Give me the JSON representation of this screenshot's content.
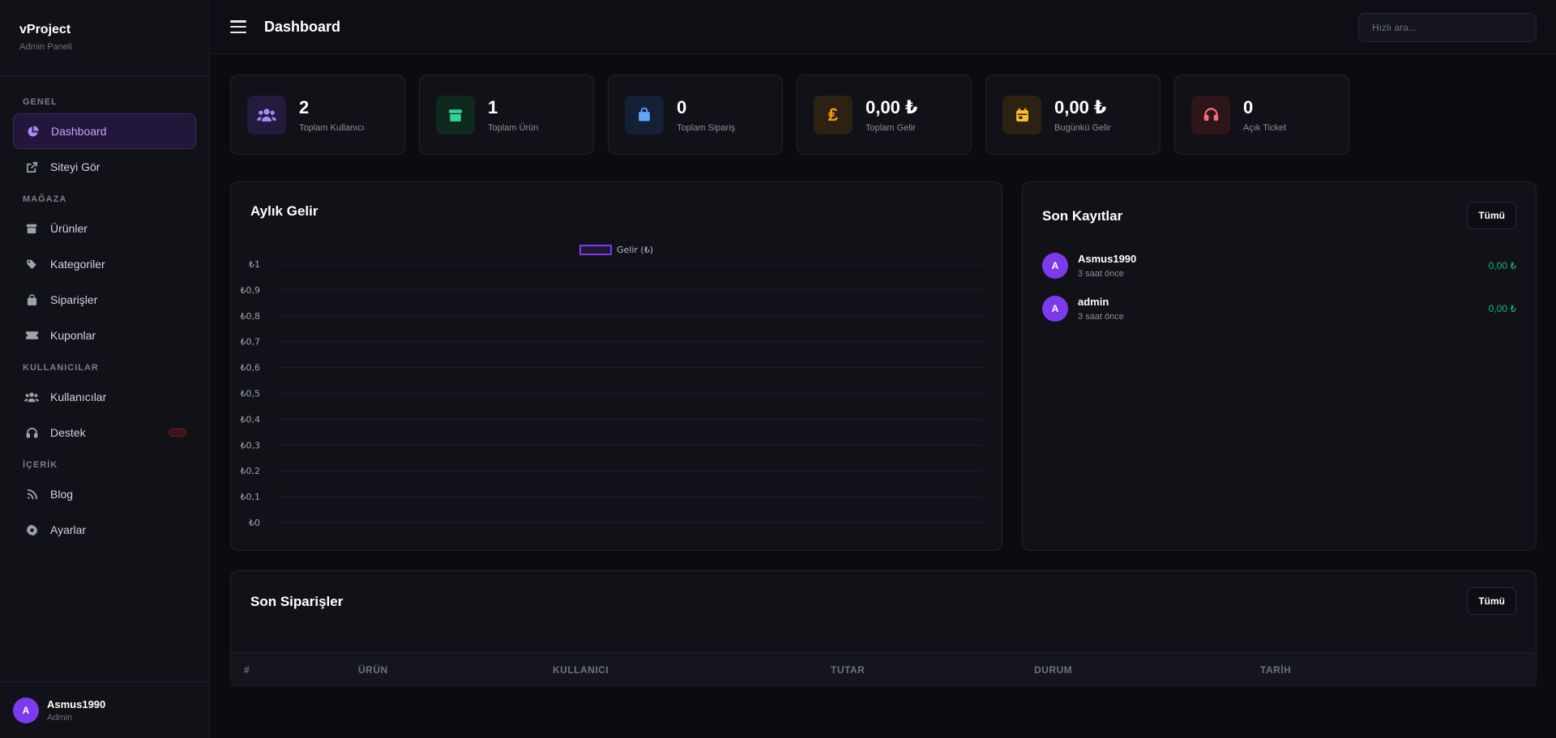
{
  "brand": {
    "name": "vProject",
    "subtitle": "Admin Paneli"
  },
  "sidebar": {
    "sections": {
      "general": "GENEL",
      "store": "MAĞAZA",
      "users": "KULLANICILAR",
      "content": "İÇERİK"
    },
    "items": {
      "dashboard": "Dashboard",
      "view_site": "Siteyi Gör",
      "products": "Ürünler",
      "categories": "Kategoriler",
      "orders": "Siparişler",
      "coupons": "Kuponlar",
      "users": "Kullanıcılar",
      "support": "Destek",
      "blog": "Blog",
      "settings": "Ayarlar"
    },
    "user": {
      "initial": "A",
      "name": "Asmus1990",
      "role": "Admin"
    }
  },
  "header": {
    "title": "Dashboard",
    "search_placeholder": "Hızlı ara..."
  },
  "stats": [
    {
      "value": "2",
      "label": "Toplam Kullanıcı",
      "icon": "users-icon",
      "color": "#a78bfa",
      "bg": "#241a3d"
    },
    {
      "value": "1",
      "label": "Toplam Ürün",
      "icon": "box-icon",
      "color": "#34d399",
      "bg": "#10291f"
    },
    {
      "value": "0",
      "label": "Toplam Sipariş",
      "icon": "shopping-bag-icon",
      "color": "#60a5fa",
      "bg": "#132036"
    },
    {
      "value": "0,00 ₺",
      "label": "Toplam Gelir",
      "icon": "lira-icon",
      "color": "#f59e0b",
      "bg": "#2d2114"
    },
    {
      "value": "0,00 ₺",
      "label": "Bugünkü Gelir",
      "icon": "calendar-icon",
      "color": "#fbbf24",
      "bg": "#2d2114"
    },
    {
      "value": "0",
      "label": "Açık Ticket",
      "icon": "headset-icon",
      "color": "#f87171",
      "bg": "#2d1519"
    }
  ],
  "chart_panel": {
    "title": "Aylık Gelir"
  },
  "chart_data": {
    "type": "line",
    "title": "Aylık Gelir",
    "series": [
      {
        "name": "Gelir (₺)",
        "values": []
      }
    ],
    "ylim": [
      0,
      1
    ],
    "yticks": [
      "₺1",
      "₺0,9",
      "₺0,8",
      "₺0,7",
      "₺0,6",
      "₺0,5",
      "₺0,4",
      "₺0,3",
      "₺0,2",
      "₺0,1",
      "₺0"
    ],
    "grid": true,
    "legend": "top-center",
    "color": "#7c3aed"
  },
  "recent_registrations": {
    "title": "Son Kayıtlar",
    "all_label": "Tümü",
    "items": [
      {
        "initial": "A",
        "name": "Asmus1990",
        "time": "3 saat önce",
        "amount": "0,00 ₺"
      },
      {
        "initial": "A",
        "name": "admin",
        "time": "3 saat önce",
        "amount": "0,00 ₺"
      }
    ]
  },
  "recent_orders": {
    "title": "Son Siparişler",
    "all_label": "Tümü",
    "columns": [
      "#",
      "ÜRÜN",
      "KULLANICI",
      "TUTAR",
      "DURUM",
      "TARİH"
    ]
  }
}
